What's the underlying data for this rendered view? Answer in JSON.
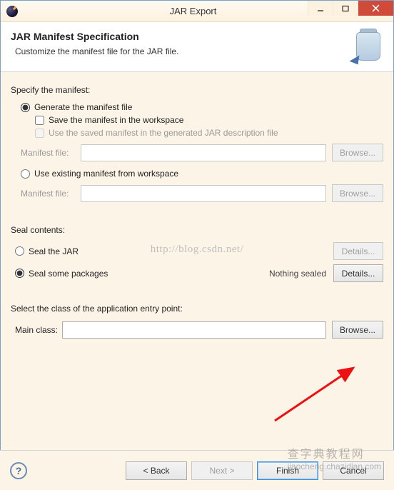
{
  "title": "JAR Export",
  "header": {
    "heading": "JAR Manifest Specification",
    "subheading": "Customize the manifest file for the JAR file."
  },
  "sections": {
    "manifest": {
      "label": "Specify the manifest:",
      "generate": "Generate the manifest file",
      "save_workspace": "Save the manifest in the workspace",
      "use_saved": "Use the saved manifest in the generated JAR description file",
      "manifest_file_label": "Manifest file:",
      "browse": "Browse...",
      "use_existing": "Use existing manifest from workspace"
    },
    "seal": {
      "label": "Seal contents:",
      "seal_jar": "Seal the JAR",
      "seal_packages": "Seal some packages",
      "nothing_sealed": "Nothing sealed",
      "details": "Details..."
    },
    "main_class": {
      "label": "Select the class of the application entry point:",
      "field_label": "Main class:",
      "browse": "Browse..."
    }
  },
  "buttons": {
    "back": "< Back",
    "next": "Next >",
    "finish": "Finish",
    "cancel": "Cancel"
  },
  "watermark": "http://blog.csdn.net/",
  "watermark2_cn": "查字典教程网",
  "watermark2_url": "jiaocheng.chazidian.com",
  "help_glyph": "?"
}
